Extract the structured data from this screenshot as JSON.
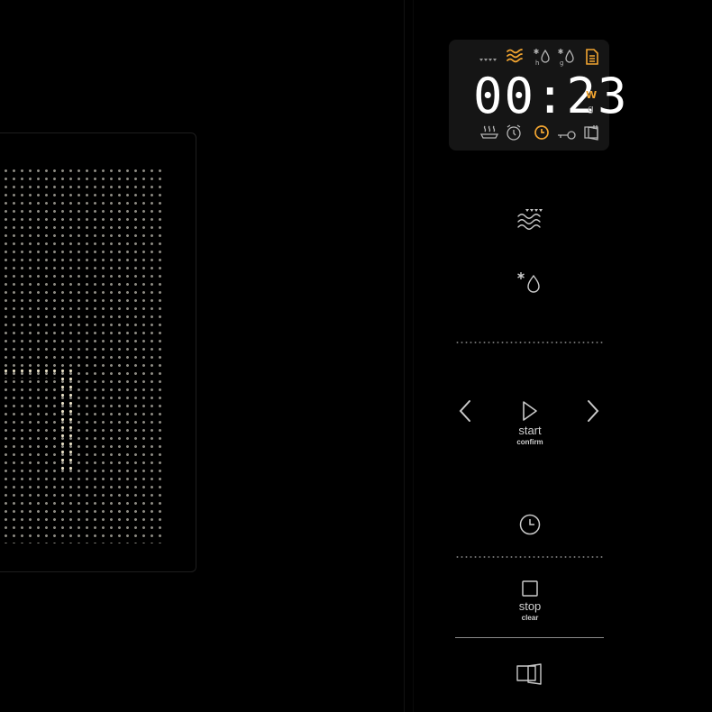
{
  "display": {
    "time": "00:23",
    "unit_top": "W",
    "unit_bottom": "g",
    "top_icons": [
      "grill-level-icon",
      "microwave-icon",
      "defrost-by-time-icon",
      "defrost-by-weight-icon",
      "recipe-book-icon"
    ],
    "bottom_icons": [
      "keep-warm-icon",
      "timer-icon",
      "clock-icon",
      "key-lock-icon",
      "door-open-icon"
    ],
    "active_icons": [
      "microwave-icon",
      "recipe-book-icon",
      "clock-icon"
    ]
  },
  "controls": {
    "start_label": "start",
    "start_sublabel": "confirm",
    "stop_label": "stop",
    "stop_sublabel": "clear"
  },
  "colors": {
    "background": "#000000",
    "display_bg": "#151515",
    "active": "#f2a531",
    "inactive": "#b5b5b5",
    "digits": "#ffffff",
    "control_icon": "#c9c9c9"
  }
}
